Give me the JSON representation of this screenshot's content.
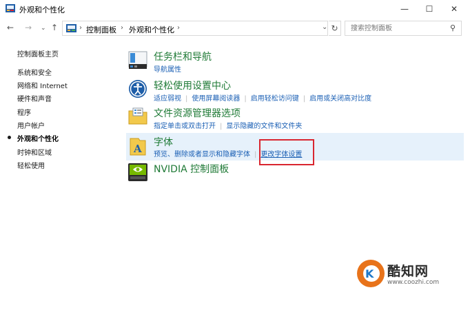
{
  "window": {
    "title": "外观和个性化",
    "minimize": "—",
    "maximize": "☐",
    "close": "✕"
  },
  "nav": {
    "back": "←",
    "forward": "→",
    "recent": "⌄",
    "up": "↑"
  },
  "address": {
    "separator": "›",
    "crumbs": [
      "控制面板",
      "外观和个性化"
    ],
    "dropdown": "⌄",
    "refresh": "↻"
  },
  "search": {
    "placeholder": "搜索控制面板"
  },
  "sidebar": {
    "items": [
      {
        "label": "控制面板主页"
      },
      {
        "label": "系统和安全"
      },
      {
        "label": "网络和 Internet"
      },
      {
        "label": "硬件和声音"
      },
      {
        "label": "程序"
      },
      {
        "label": "用户帐户"
      },
      {
        "label": "外观和个性化",
        "active": true
      },
      {
        "label": "时钟和区域"
      },
      {
        "label": "轻松使用"
      }
    ]
  },
  "categories": [
    {
      "title": "任务栏和导航",
      "icon": "taskbar-icon",
      "links": [
        "导航属性"
      ]
    },
    {
      "title": "轻松使用设置中心",
      "icon": "ease-of-access-icon",
      "links": [
        "适应弱视",
        "使用屏幕阅读器",
        "启用轻松访问键",
        "启用或关闭高对比度"
      ]
    },
    {
      "title": "文件资源管理器选项",
      "icon": "folder-options-icon",
      "links": [
        "指定单击或双击打开",
        "显示隐藏的文件和文件夹"
      ]
    },
    {
      "title": "字体",
      "icon": "fonts-folder-icon",
      "links": [
        "预览、删除或者显示和隐藏字体",
        "更改字体设置"
      ]
    },
    {
      "title": "NVIDIA 控制面板",
      "icon": "nvidia-icon",
      "links": []
    }
  ],
  "watermark": {
    "name": "酷知网",
    "url": "www.coozhi.com",
    "logo_letter": "K",
    "logo_color": "#e8731a"
  },
  "colors": {
    "category_title": "#1f7a36",
    "link": "#1a5fb4",
    "highlight_bg": "#e6f1fb",
    "annotation_box": "#d9252f"
  }
}
